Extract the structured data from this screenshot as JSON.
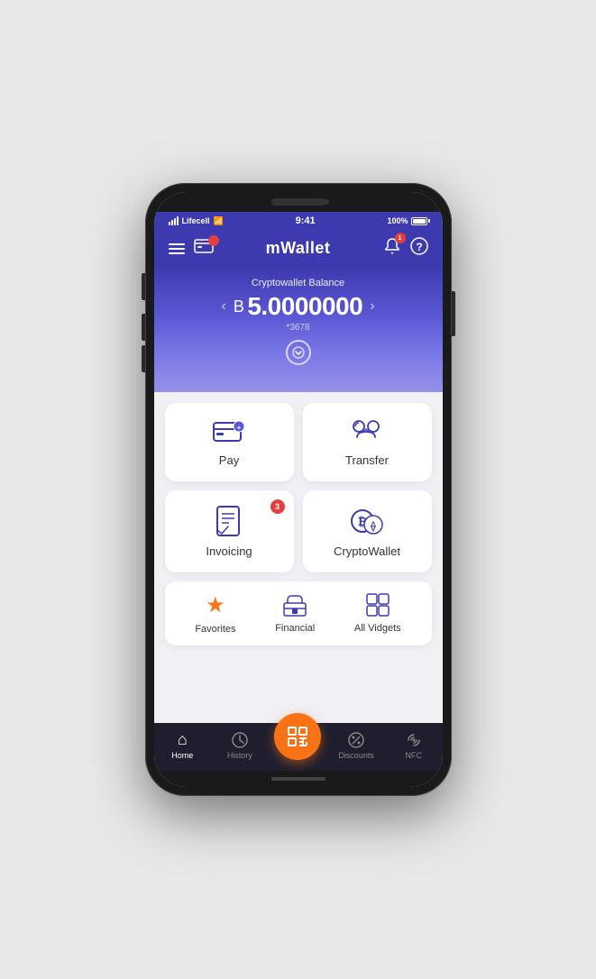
{
  "status_bar": {
    "carrier": "Lifecell",
    "time": "9:41",
    "battery": "100%"
  },
  "header": {
    "title": "mWallet",
    "card_badge": "",
    "notification_badge": ""
  },
  "balance": {
    "label": "Cryptowallet Balance",
    "currency_symbol": "B",
    "amount": "5.0000000",
    "account": "*3678"
  },
  "actions": [
    {
      "id": "pay",
      "label": "Pay",
      "badge": null
    },
    {
      "id": "transfer",
      "label": "Transfer",
      "badge": null
    },
    {
      "id": "invoicing",
      "label": "Invoicing",
      "badge": "3"
    },
    {
      "id": "cryptowallet",
      "label": "CryptoWallet",
      "badge": null
    }
  ],
  "widgets": [
    {
      "id": "favorites",
      "label": "Favorites",
      "color": "orange"
    },
    {
      "id": "financial",
      "label": "Financial",
      "color": "blue"
    },
    {
      "id": "all_vidgets",
      "label": "All Vidgets",
      "color": "blue"
    }
  ],
  "bottom_nav": [
    {
      "id": "home",
      "label": "Home",
      "active": true
    },
    {
      "id": "history",
      "label": "History",
      "active": false
    },
    {
      "id": "scan",
      "label": "",
      "active": false,
      "is_scan": true
    },
    {
      "id": "discounts",
      "label": "Discounts",
      "active": false
    },
    {
      "id": "nfc",
      "label": "NFC",
      "active": false
    }
  ]
}
